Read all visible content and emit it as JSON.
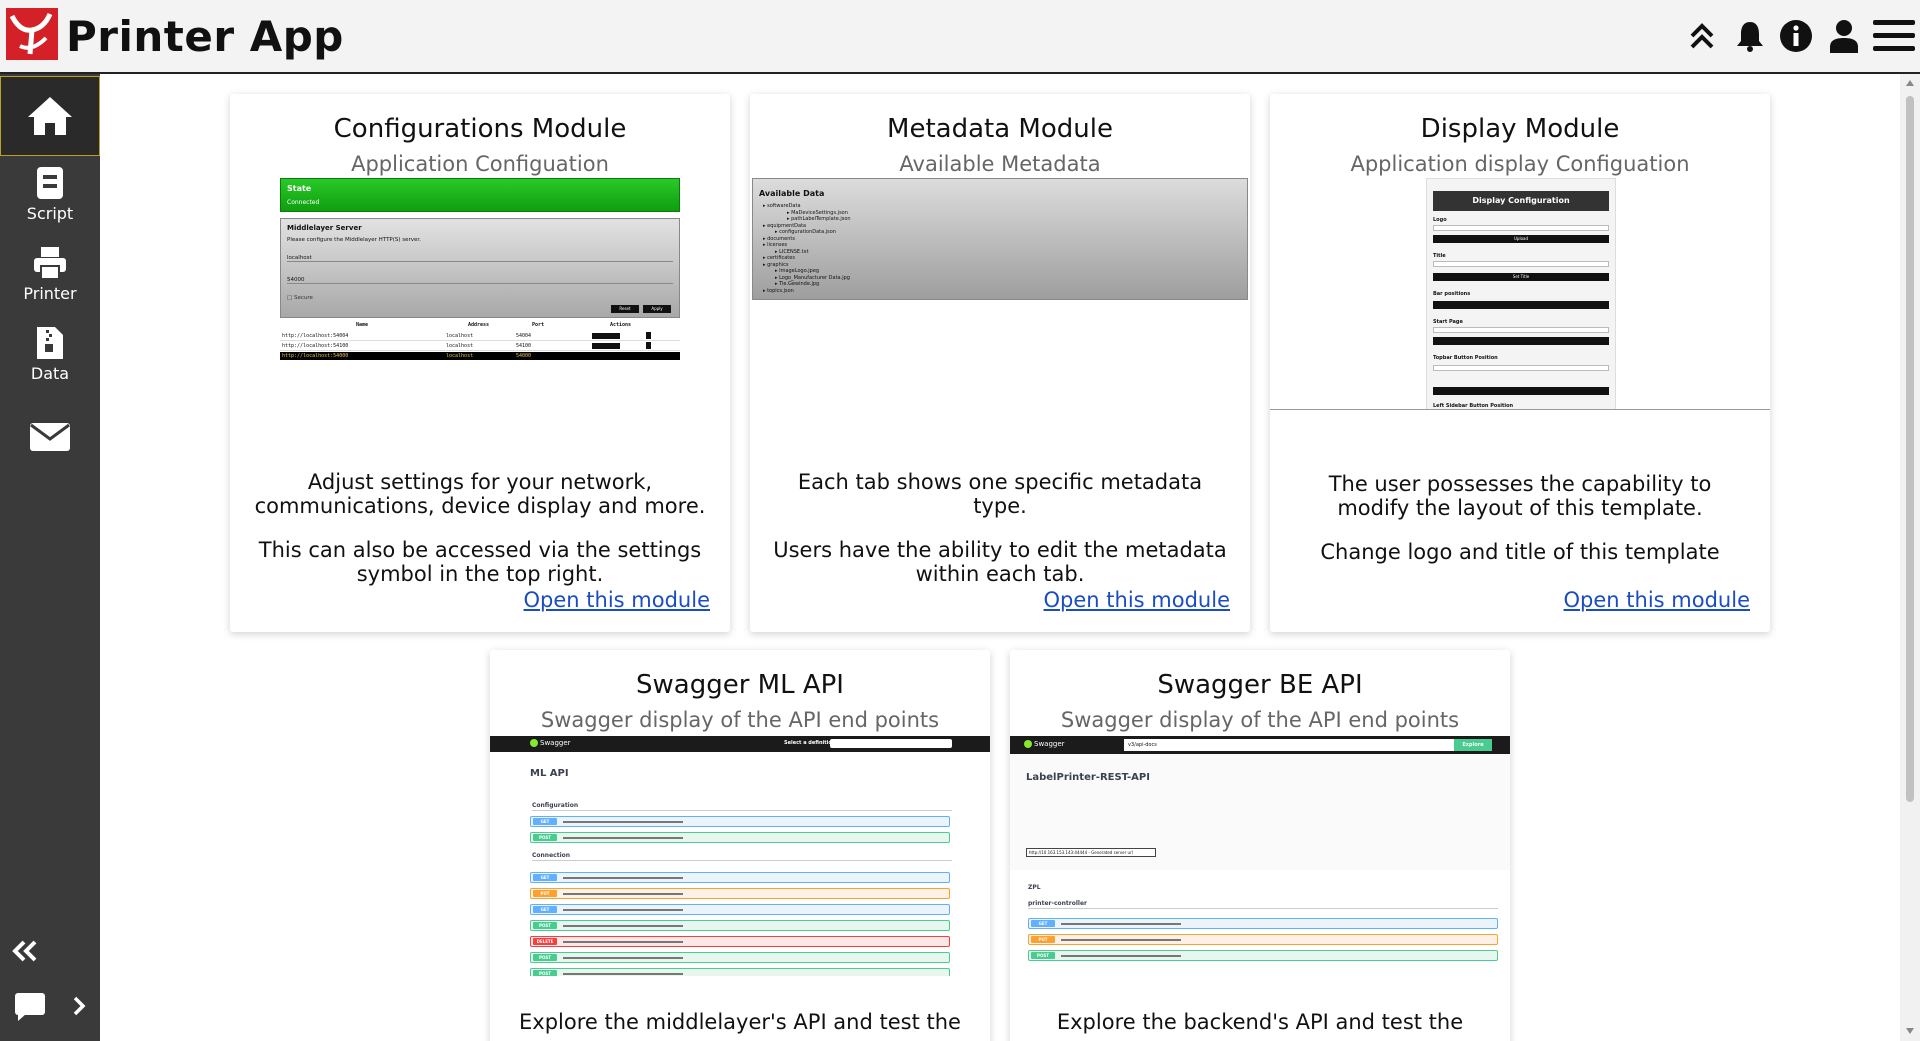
{
  "header": {
    "title": "Printer App",
    "icons": [
      "chevrons-up-icon",
      "bell-icon",
      "info-icon",
      "user-icon",
      "hamburger-menu-icon"
    ]
  },
  "sidebar": {
    "items": [
      {
        "label": "",
        "icon": "home-icon"
      },
      {
        "label": "Script",
        "icon": "script-icon"
      },
      {
        "label": "Printer",
        "icon": "printer-icon"
      },
      {
        "label": "Data",
        "icon": "data-file-icon"
      },
      {
        "label": "",
        "icon": "mail-icon"
      }
    ],
    "bottom_icons": [
      "collapse-double-left-icon",
      "chat-icon",
      "chevron-right-icon"
    ]
  },
  "cards": [
    {
      "title": "Configurations Module",
      "subtitle": "Application Configuation",
      "desc1": "Adjust settings for your network, communications, device display and more.",
      "desc2": "This can also be accessed via the settings symbol in the top right.",
      "link": "Open this module"
    },
    {
      "title": "Metadata Module",
      "subtitle": "Available Metadata",
      "desc1": "Each tab shows one specific metadata type.",
      "desc2": "Users have the ability to edit the metadata within each tab.",
      "link": "Open this module"
    },
    {
      "title": "Display Module",
      "subtitle": "Application display Configuation",
      "desc1": "The user possesses the capability to modify the layout of this template.",
      "desc2": "Change logo and title of this template",
      "link": "Open this module"
    },
    {
      "title": "Swagger ML API",
      "subtitle": "Swagger display of the API end points",
      "desc1": "Explore the middlelayer's API and test the"
    },
    {
      "title": "Swagger BE API",
      "subtitle": "Swagger display of the API end points",
      "desc1": "Explore the backend's API and test the"
    }
  ],
  "thumbs": {
    "config": {
      "state": "State",
      "connected": "Connected",
      "server": "Middlelayer Server",
      "hint": "Please configure the Middlelayer HTTP(S) server.",
      "host": "localhost",
      "port": "54000",
      "checkbox": "Secure",
      "btn1": "Reset",
      "btn2": "Apply",
      "cols": [
        "Name",
        "Address",
        "Port",
        "Actions"
      ],
      "rows": [
        [
          "http://localhost:54004",
          "localhost",
          "54004"
        ],
        [
          "http://localhost:54100",
          "localhost",
          "54100"
        ],
        [
          "http://localhost:54000",
          "localhost",
          "54000"
        ]
      ]
    },
    "metadata": {
      "heading": "Available Data",
      "tree": [
        "softwareData",
        "MaDeviceSettings.json",
        "pathLabelTemplate.json",
        "equipmentData",
        "configurationData.json",
        "documents",
        "licenses",
        "LICENSE.txt",
        "certificates",
        "graphics",
        "ImageLogo.jpeg",
        "Logo_Manufacturer Data.jpg",
        "Tie.Gewinde.jpg",
        "topics.json"
      ]
    },
    "display": {
      "heading": "Display Configuration",
      "logo": "Logo",
      "title": "Title",
      "bar": "Bar positions",
      "start": "Start Page",
      "topbar": "Topbar Button Position",
      "left": "Left Sidebar Button Position",
      "upload": "Upload",
      "set": "Set Title"
    },
    "swagger_ml": {
      "brand": "Swagger",
      "select": "Select a definition",
      "api": "ML API",
      "sec1": "Configuration",
      "sec2": "Connection",
      "rows": [
        {
          "m": "GET",
          "c": "#61affe",
          "bg": "#ebf3fb"
        },
        {
          "m": "POST",
          "c": "#49cc90",
          "bg": "#e8f6f0"
        },
        {
          "m": "GET",
          "c": "#61affe",
          "bg": "#ebf3fb"
        },
        {
          "m": "PUT",
          "c": "#fca130",
          "bg": "#fbf1e6"
        },
        {
          "m": "GET",
          "c": "#61affe",
          "bg": "#ebf3fb"
        },
        {
          "m": "POST",
          "c": "#49cc90",
          "bg": "#e8f6f0"
        },
        {
          "m": "DELETE",
          "c": "#f93e3e",
          "bg": "#fae7e7"
        },
        {
          "m": "POST",
          "c": "#49cc90",
          "bg": "#e8f6f0"
        },
        {
          "m": "POST",
          "c": "#49cc90",
          "bg": "#e8f6f0"
        }
      ]
    },
    "swagger_be": {
      "brand": "Swagger",
      "url": "v3/api-docs",
      "explore": "Explore",
      "api": "LabelPrinter-REST-API",
      "servers": "http://10.163.153.143:44444 - Generated server url",
      "zpl": "ZPL",
      "controller": "printer-controller",
      "rows": [
        {
          "m": "GET",
          "c": "#61affe",
          "bg": "#ebf3fb"
        },
        {
          "m": "PUT",
          "c": "#fca130",
          "bg": "#fbf1e6"
        },
        {
          "m": "POST",
          "c": "#49cc90",
          "bg": "#e8f6f0"
        }
      ]
    }
  }
}
